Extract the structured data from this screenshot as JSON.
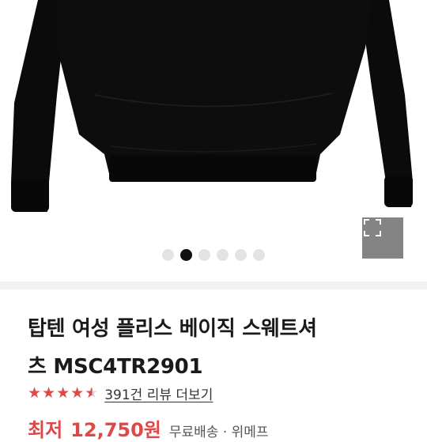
{
  "product": {
    "title": "탑텐 여성 플리스 베이직 스웨트셔츠 MSC4TR2901",
    "title_line1": "탑텐 여성 플리스 베이직 스웨트셔",
    "title_line2": "츠 MSC4TR2901",
    "rating": 4.5,
    "review_link": "391건 리뷰 더보기",
    "price_label": "최저",
    "price_value": "12,750원",
    "shipping": "무료배송 · 위메프"
  },
  "carousel": {
    "total": 6,
    "active_index": 1
  },
  "icons": {
    "zoom": "expand-icon",
    "star": "star-icon"
  },
  "colors": {
    "accent": "#e04848",
    "garment": "#0b0b0b"
  }
}
